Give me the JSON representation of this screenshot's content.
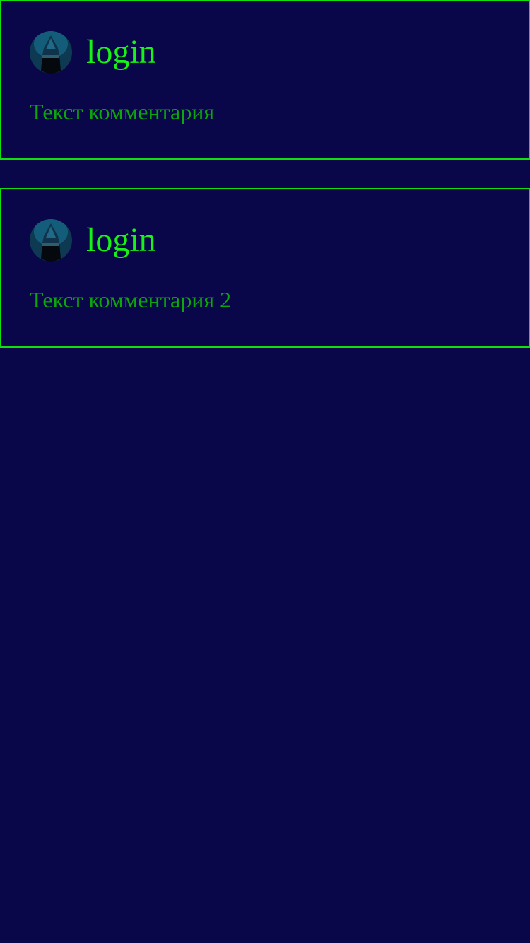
{
  "comments": [
    {
      "login": "login",
      "text": "Текст комментария",
      "avatar_icon": "hooded-hacker-avatar"
    },
    {
      "login": "login",
      "text": "Текст комментария 2",
      "avatar_icon": "hooded-hacker-avatar"
    }
  ],
  "colors": {
    "background": "#09064a",
    "border": "#10e010",
    "login": "#17f217",
    "text": "#0ca70c"
  }
}
